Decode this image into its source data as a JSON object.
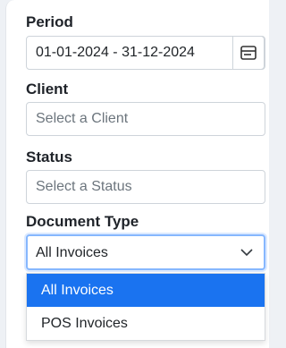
{
  "filters": {
    "period": {
      "label": "Period",
      "value": "01-01-2024 - 31-12-2024",
      "icon": "calendar-icon"
    },
    "client": {
      "label": "Client",
      "placeholder": "Select a Client"
    },
    "status": {
      "label": "Status",
      "placeholder": "Select a Status"
    },
    "document_type": {
      "label": "Document Type",
      "value": "All Invoices",
      "icon": "chevron-down-icon",
      "options": [
        {
          "label": "All Invoices",
          "selected": true
        },
        {
          "label": "POS Invoices",
          "selected": false
        }
      ]
    }
  },
  "colors": {
    "accent": "#1a73f0",
    "focus_border": "#86b7fe"
  }
}
